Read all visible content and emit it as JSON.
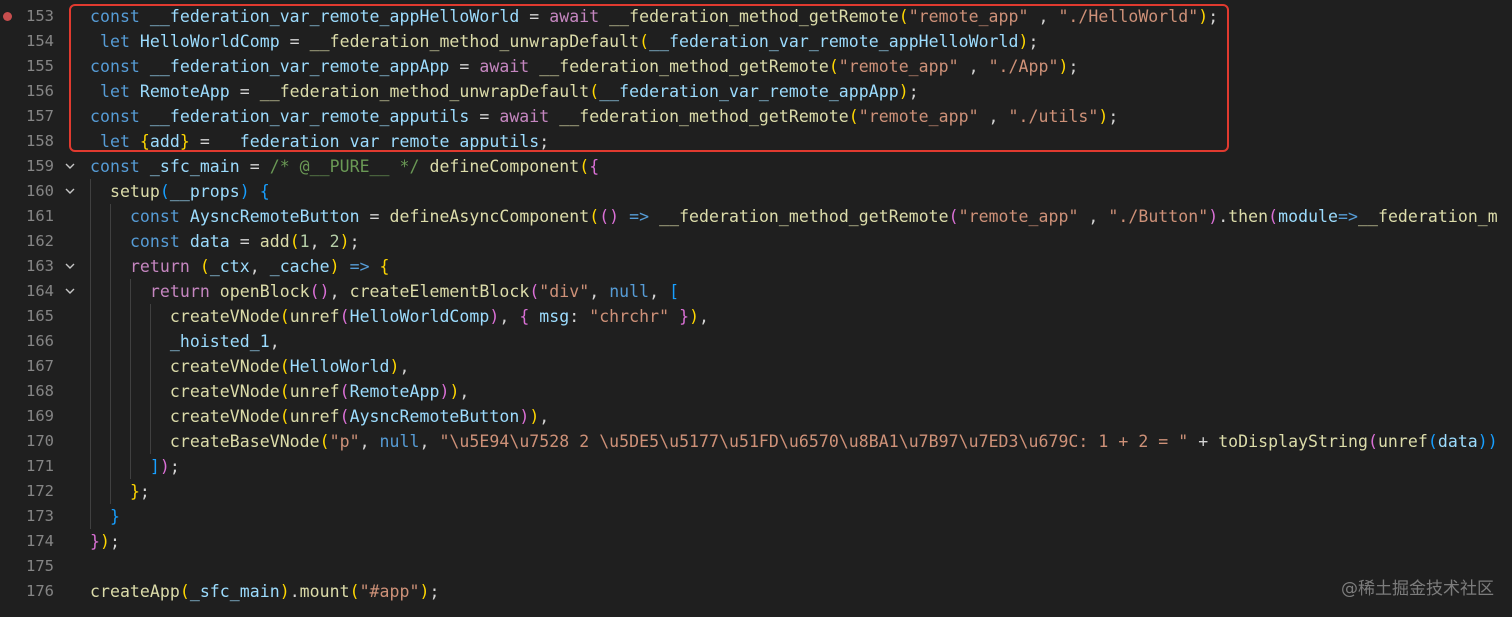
{
  "lines": [
    {
      "number": "153",
      "breakpoint": true,
      "fold": false
    },
    {
      "number": "154",
      "breakpoint": false,
      "fold": false
    },
    {
      "number": "155",
      "breakpoint": false,
      "fold": false
    },
    {
      "number": "156",
      "breakpoint": false,
      "fold": false
    },
    {
      "number": "157",
      "breakpoint": false,
      "fold": false
    },
    {
      "number": "158",
      "breakpoint": false,
      "fold": false
    },
    {
      "number": "159",
      "breakpoint": false,
      "fold": true
    },
    {
      "number": "160",
      "breakpoint": false,
      "fold": true
    },
    {
      "number": "161",
      "breakpoint": false,
      "fold": false
    },
    {
      "number": "162",
      "breakpoint": false,
      "fold": false
    },
    {
      "number": "163",
      "breakpoint": false,
      "fold": true
    },
    {
      "number": "164",
      "breakpoint": false,
      "fold": true
    },
    {
      "number": "165",
      "breakpoint": false,
      "fold": false
    },
    {
      "number": "166",
      "breakpoint": false,
      "fold": false
    },
    {
      "number": "167",
      "breakpoint": false,
      "fold": false
    },
    {
      "number": "168",
      "breakpoint": false,
      "fold": false
    },
    {
      "number": "169",
      "breakpoint": false,
      "fold": false
    },
    {
      "number": "170",
      "breakpoint": false,
      "fold": false
    },
    {
      "number": "171",
      "breakpoint": false,
      "fold": false
    },
    {
      "number": "172",
      "breakpoint": false,
      "fold": false
    },
    {
      "number": "173",
      "breakpoint": false,
      "fold": false
    },
    {
      "number": "174",
      "breakpoint": false,
      "fold": false
    },
    {
      "number": "175",
      "breakpoint": false,
      "fold": false
    },
    {
      "number": "176",
      "breakpoint": false,
      "fold": false
    }
  ],
  "code": [
    [
      [
        "k",
        "const "
      ],
      [
        "v",
        "__federation_var_remote_appHelloWorld"
      ],
      [
        "o",
        " = "
      ],
      [
        "c",
        "await "
      ],
      [
        "f",
        "__federation_method_getRemote"
      ],
      [
        "b1",
        "("
      ],
      [
        "s",
        "\"remote_app\""
      ],
      [
        "o",
        " , "
      ],
      [
        "s",
        "\"./HelloWorld\""
      ],
      [
        "b1",
        ")"
      ],
      [
        "o",
        ";"
      ]
    ],
    [
      [
        "o",
        " "
      ],
      [
        "k",
        "let "
      ],
      [
        "v",
        "HelloWorldComp"
      ],
      [
        "o",
        " = "
      ],
      [
        "f",
        "__federation_method_unwrapDefault"
      ],
      [
        "b1",
        "("
      ],
      [
        "v",
        "__federation_var_remote_appHelloWorld"
      ],
      [
        "b1",
        ")"
      ],
      [
        "o",
        ";"
      ]
    ],
    [
      [
        "k",
        "const "
      ],
      [
        "v",
        "__federation_var_remote_appApp"
      ],
      [
        "o",
        " = "
      ],
      [
        "c",
        "await "
      ],
      [
        "f",
        "__federation_method_getRemote"
      ],
      [
        "b1",
        "("
      ],
      [
        "s",
        "\"remote_app\""
      ],
      [
        "o",
        " , "
      ],
      [
        "s",
        "\"./App\""
      ],
      [
        "b1",
        ")"
      ],
      [
        "o",
        ";"
      ]
    ],
    [
      [
        "o",
        " "
      ],
      [
        "k",
        "let "
      ],
      [
        "v",
        "RemoteApp"
      ],
      [
        "o",
        " = "
      ],
      [
        "f",
        "__federation_method_unwrapDefault"
      ],
      [
        "b1",
        "("
      ],
      [
        "v",
        "__federation_var_remote_appApp"
      ],
      [
        "b1",
        ")"
      ],
      [
        "o",
        ";"
      ]
    ],
    [
      [
        "k",
        "const "
      ],
      [
        "v",
        "__federation_var_remote_apputils"
      ],
      [
        "o",
        " = "
      ],
      [
        "c",
        "await "
      ],
      [
        "f",
        "__federation_method_getRemote"
      ],
      [
        "b1",
        "("
      ],
      [
        "s",
        "\"remote_app\""
      ],
      [
        "o",
        " , "
      ],
      [
        "s",
        "\"./utils\""
      ],
      [
        "b1",
        ")"
      ],
      [
        "o",
        ";"
      ]
    ],
    [
      [
        "o",
        " "
      ],
      [
        "k",
        "let "
      ],
      [
        "b1",
        "{"
      ],
      [
        "v",
        "add"
      ],
      [
        "b1",
        "}"
      ],
      [
        "o",
        " = "
      ],
      [
        "v",
        "__federation_var_remote_apputils"
      ],
      [
        "o",
        ";"
      ]
    ],
    [
      [
        "k",
        "const "
      ],
      [
        "v",
        "_sfc_main"
      ],
      [
        "o",
        " = "
      ],
      [
        "m",
        "/* @__PURE__ */"
      ],
      [
        "o",
        " "
      ],
      [
        "f",
        "defineComponent"
      ],
      [
        "b1",
        "("
      ],
      [
        "b2",
        "{"
      ]
    ],
    [
      [
        "o",
        "  "
      ],
      [
        "f",
        "setup"
      ],
      [
        "b3",
        "("
      ],
      [
        "v",
        "__props"
      ],
      [
        "b3",
        ")"
      ],
      [
        "o",
        " "
      ],
      [
        "b3",
        "{"
      ]
    ],
    [
      [
        "o",
        "    "
      ],
      [
        "k",
        "const "
      ],
      [
        "v",
        "AysncRemoteButton"
      ],
      [
        "o",
        " = "
      ],
      [
        "f",
        "defineAsyncComponent"
      ],
      [
        "b1",
        "("
      ],
      [
        "b2",
        "()"
      ],
      [
        "o",
        " "
      ],
      [
        "k",
        "=>"
      ],
      [
        "o",
        " "
      ],
      [
        "f",
        "__federation_method_getRemote"
      ],
      [
        "b2",
        "("
      ],
      [
        "s",
        "\"remote_app\""
      ],
      [
        "o",
        " , "
      ],
      [
        "s",
        "\"./Button\""
      ],
      [
        "b2",
        ")"
      ],
      [
        "o",
        "."
      ],
      [
        "f",
        "then"
      ],
      [
        "b2",
        "("
      ],
      [
        "v",
        "module"
      ],
      [
        "k",
        "=>"
      ],
      [
        "f",
        "__federation_m"
      ]
    ],
    [
      [
        "o",
        "    "
      ],
      [
        "k",
        "const "
      ],
      [
        "v",
        "data"
      ],
      [
        "o",
        " = "
      ],
      [
        "f",
        "add"
      ],
      [
        "b1",
        "("
      ],
      [
        "n",
        "1"
      ],
      [
        "o",
        ", "
      ],
      [
        "n",
        "2"
      ],
      [
        "b1",
        ")"
      ],
      [
        "o",
        ";"
      ]
    ],
    [
      [
        "o",
        "    "
      ],
      [
        "c",
        "return "
      ],
      [
        "b1",
        "("
      ],
      [
        "v",
        "_ctx"
      ],
      [
        "o",
        ", "
      ],
      [
        "v",
        "_cache"
      ],
      [
        "b1",
        ")"
      ],
      [
        "o",
        " "
      ],
      [
        "k",
        "=>"
      ],
      [
        "o",
        " "
      ],
      [
        "b1",
        "{"
      ]
    ],
    [
      [
        "o",
        "      "
      ],
      [
        "c",
        "return "
      ],
      [
        "f",
        "openBlock"
      ],
      [
        "b2",
        "()"
      ],
      [
        "o",
        ", "
      ],
      [
        "f",
        "createElementBlock"
      ],
      [
        "b2",
        "("
      ],
      [
        "s",
        "\"div\""
      ],
      [
        "o",
        ", "
      ],
      [
        "k",
        "null"
      ],
      [
        "o",
        ", "
      ],
      [
        "b3",
        "["
      ]
    ],
    [
      [
        "o",
        "        "
      ],
      [
        "f",
        "createVNode"
      ],
      [
        "b1",
        "("
      ],
      [
        "f",
        "unref"
      ],
      [
        "b2",
        "("
      ],
      [
        "v",
        "HelloWorldComp"
      ],
      [
        "b2",
        ")"
      ],
      [
        "o",
        ", "
      ],
      [
        "b2",
        "{"
      ],
      [
        "o",
        " "
      ],
      [
        "v",
        "msg"
      ],
      [
        "o",
        ": "
      ],
      [
        "s",
        "\"chrchr\""
      ],
      [
        "o",
        " "
      ],
      [
        "b2",
        "}"
      ],
      [
        "b1",
        ")"
      ],
      [
        "o",
        ","
      ]
    ],
    [
      [
        "o",
        "        "
      ],
      [
        "v",
        "_hoisted_1"
      ],
      [
        "o",
        ","
      ]
    ],
    [
      [
        "o",
        "        "
      ],
      [
        "f",
        "createVNode"
      ],
      [
        "b1",
        "("
      ],
      [
        "v",
        "HelloWorld"
      ],
      [
        "b1",
        ")"
      ],
      [
        "o",
        ","
      ]
    ],
    [
      [
        "o",
        "        "
      ],
      [
        "f",
        "createVNode"
      ],
      [
        "b1",
        "("
      ],
      [
        "f",
        "unref"
      ],
      [
        "b2",
        "("
      ],
      [
        "v",
        "RemoteApp"
      ],
      [
        "b2",
        ")"
      ],
      [
        "b1",
        ")"
      ],
      [
        "o",
        ","
      ]
    ],
    [
      [
        "o",
        "        "
      ],
      [
        "f",
        "createVNode"
      ],
      [
        "b1",
        "("
      ],
      [
        "f",
        "unref"
      ],
      [
        "b2",
        "("
      ],
      [
        "v",
        "AysncRemoteButton"
      ],
      [
        "b2",
        ")"
      ],
      [
        "b1",
        ")"
      ],
      [
        "o",
        ","
      ]
    ],
    [
      [
        "o",
        "        "
      ],
      [
        "f",
        "createBaseVNode"
      ],
      [
        "b1",
        "("
      ],
      [
        "s",
        "\"p\""
      ],
      [
        "o",
        ", "
      ],
      [
        "k",
        "null"
      ],
      [
        "o",
        ", "
      ],
      [
        "s",
        "\"\\u5E94\\u7528 2 \\u5DE5\\u5177\\u51FD\\u6570\\u8BA1\\u7B97\\u7ED3\\u679C: 1 + 2 = \""
      ],
      [
        "o",
        " + "
      ],
      [
        "f",
        "toDisplayString"
      ],
      [
        "b2",
        "("
      ],
      [
        "f",
        "unref"
      ],
      [
        "b3",
        "("
      ],
      [
        "v",
        "data"
      ],
      [
        "b3",
        "))"
      ]
    ],
    [
      [
        "o",
        "      "
      ],
      [
        "b3",
        "]"
      ],
      [
        "b2",
        ")"
      ],
      [
        "o",
        ";"
      ]
    ],
    [
      [
        "o",
        "    "
      ],
      [
        "b1",
        "}"
      ],
      [
        "o",
        ";"
      ]
    ],
    [
      [
        "o",
        "  "
      ],
      [
        "b3",
        "}"
      ]
    ],
    [
      [
        "b2",
        "}"
      ],
      [
        "b1",
        ")"
      ],
      [
        "o",
        ";"
      ]
    ],
    [],
    [
      [
        "f",
        "createApp"
      ],
      [
        "b1",
        "("
      ],
      [
        "v",
        "_sfc_main"
      ],
      [
        "b1",
        ")"
      ],
      [
        "o",
        "."
      ],
      [
        "f",
        "mount"
      ],
      [
        "b1",
        "("
      ],
      [
        "s",
        "\"#app\""
      ],
      [
        "b1",
        ")"
      ],
      [
        "o",
        ";"
      ]
    ]
  ],
  "watermark": "@稀土掘金技术社区",
  "colors": {
    "background": "#1f1f1f",
    "highlight_border": "#e03a2f",
    "breakpoint": "#c74e4e",
    "line_number": "#858585"
  }
}
